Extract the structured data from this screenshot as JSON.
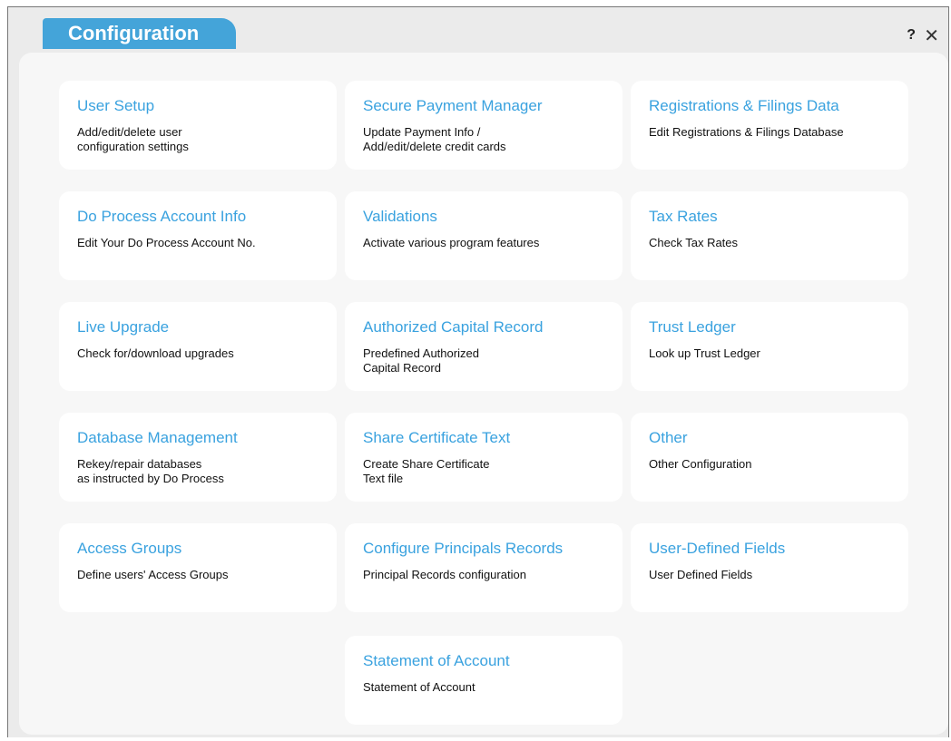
{
  "window": {
    "title": "Configuration",
    "help_label": "?",
    "close_label": "✕"
  },
  "cards": [
    {
      "title": "User Setup",
      "desc": "Add/edit/delete user\nconfiguration settings"
    },
    {
      "title": "Secure Payment Manager",
      "desc": "Update Payment Info /\nAdd/edit/delete credit cards"
    },
    {
      "title": "Registrations & Filings Data",
      "desc": "Edit Registrations & Filings Database"
    },
    {
      "title": "Do Process Account Info",
      "desc": "Edit Your Do Process Account No."
    },
    {
      "title": "Validations",
      "desc": "Activate various program features"
    },
    {
      "title": "Tax Rates",
      "desc": "Check Tax Rates"
    },
    {
      "title": "Live Upgrade",
      "desc": "Check for/download upgrades"
    },
    {
      "title": "Authorized Capital Record",
      "desc": "Predefined Authorized\nCapital Record"
    },
    {
      "title": "Trust Ledger",
      "desc": "Look up Trust Ledger"
    },
    {
      "title": "Database Management",
      "desc": "Rekey/repair databases\nas instructed by Do Process"
    },
    {
      "title": "Share Certificate Text",
      "desc": "Create Share Certificate\nText file"
    },
    {
      "title": "Other",
      "desc": "Other Configuration"
    },
    {
      "title": "Access Groups",
      "desc": "Define users' Access Groups"
    },
    {
      "title": "Configure Principals Records",
      "desc": "Principal Records configuration"
    },
    {
      "title": "User-Defined Fields",
      "desc": "User Defined Fields"
    },
    {
      "title": "Statement of Account",
      "desc": "Statement of Account"
    }
  ],
  "colors": {
    "accent": "#44a4d9",
    "card_title": "#3aa2df",
    "panel_bg": "#f7f7f7",
    "window_bg": "#ebebeb"
  }
}
